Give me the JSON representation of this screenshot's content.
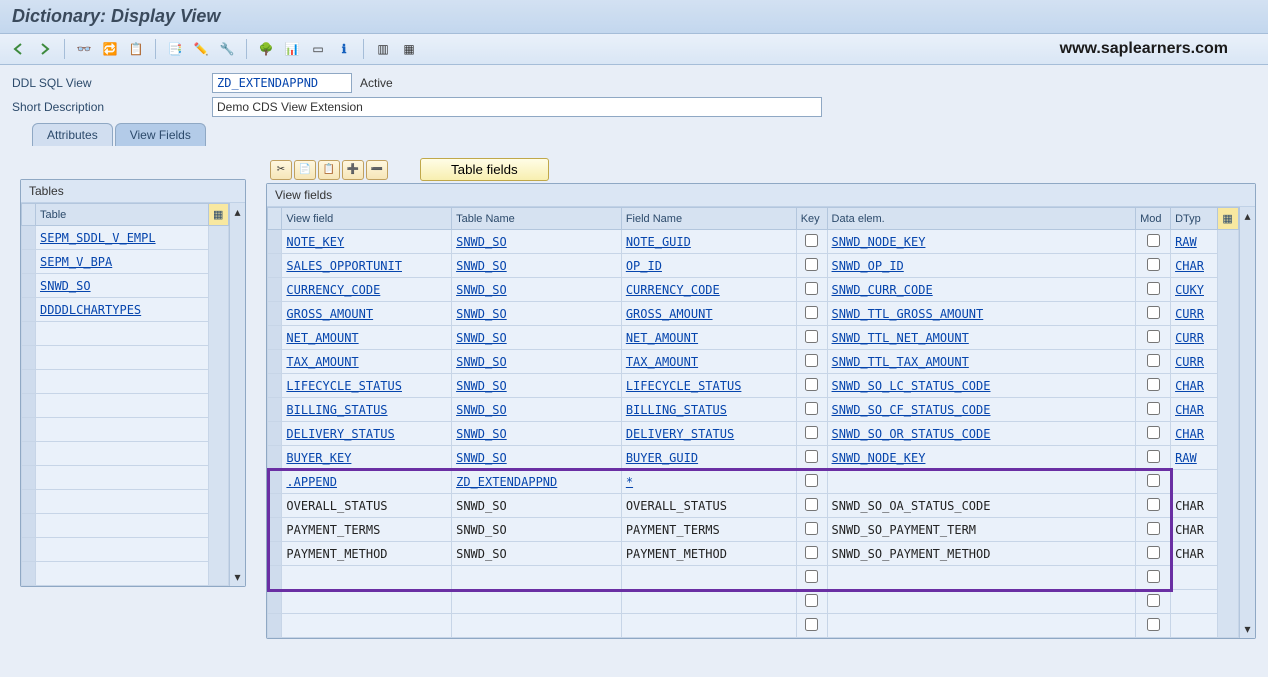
{
  "title": "Dictionary: Display View",
  "watermark": "www.saplearners.com",
  "form": {
    "ddl_label": "DDL SQL View",
    "ddl_value": "ZD_EXTENDAPPND",
    "status": "Active",
    "desc_label": "Short Description",
    "desc_value": "Demo CDS View Extension"
  },
  "tabs": {
    "attributes": "Attributes",
    "view_fields": "View Fields"
  },
  "left_panel": {
    "title": "Tables",
    "header": "Table",
    "rows": [
      "SEPM_SDDL_V_EMPL",
      "SEPM_V_BPA",
      "SNWD_SO",
      "DDDDLCHARTYPES"
    ]
  },
  "right_panel": {
    "title": "View fields",
    "button_table_fields": "Table fields",
    "headers": {
      "view_field": "View field",
      "table_name": "Table Name",
      "field_name": "Field Name",
      "key": "Key",
      "data_elem": "Data elem.",
      "mod": "Mod",
      "dtyp": "DTyp"
    },
    "rows": [
      {
        "vf": "NOTE_KEY",
        "tn": "SNWD_SO",
        "fn": "NOTE_GUID",
        "de": "SNWD_NODE_KEY",
        "dt": "RAW",
        "hl": false
      },
      {
        "vf": "SALES_OPPORTUNIT",
        "tn": "SNWD_SO",
        "fn": "OP_ID",
        "de": "SNWD_OP_ID",
        "dt": "CHAR",
        "hl": false
      },
      {
        "vf": "CURRENCY_CODE",
        "tn": "SNWD_SO",
        "fn": "CURRENCY_CODE",
        "de": "SNWD_CURR_CODE",
        "dt": "CUKY",
        "hl": false
      },
      {
        "vf": "GROSS_AMOUNT",
        "tn": "SNWD_SO",
        "fn": "GROSS_AMOUNT",
        "de": "SNWD_TTL_GROSS_AMOUNT",
        "dt": "CURR",
        "hl": false
      },
      {
        "vf": "NET_AMOUNT",
        "tn": "SNWD_SO",
        "fn": "NET_AMOUNT",
        "de": "SNWD_TTL_NET_AMOUNT",
        "dt": "CURR",
        "hl": false
      },
      {
        "vf": "TAX_AMOUNT",
        "tn": "SNWD_SO",
        "fn": "TAX_AMOUNT",
        "de": "SNWD_TTL_TAX_AMOUNT",
        "dt": "CURR",
        "hl": false
      },
      {
        "vf": "LIFECYCLE_STATUS",
        "tn": "SNWD_SO",
        "fn": "LIFECYCLE_STATUS",
        "de": "SNWD_SO_LC_STATUS_CODE",
        "dt": "CHAR",
        "hl": false
      },
      {
        "vf": "BILLING_STATUS",
        "tn": "SNWD_SO",
        "fn": "BILLING_STATUS",
        "de": "SNWD_SO_CF_STATUS_CODE",
        "dt": "CHAR",
        "hl": false
      },
      {
        "vf": "DELIVERY_STATUS",
        "tn": "SNWD_SO",
        "fn": "DELIVERY_STATUS",
        "de": "SNWD_SO_OR_STATUS_CODE",
        "dt": "CHAR",
        "hl": false
      },
      {
        "vf": "BUYER_KEY",
        "tn": "SNWD_SO",
        "fn": "BUYER_GUID",
        "de": "SNWD_NODE_KEY",
        "dt": "RAW",
        "hl": false
      },
      {
        "vf": ".APPEND",
        "tn": "ZD_EXTENDAPPND",
        "fn": "*",
        "de": "",
        "dt": "",
        "hl": true
      },
      {
        "vf": "OVERALL_STATUS",
        "tn": "SNWD_SO",
        "fn": "OVERALL_STATUS",
        "de": "SNWD_SO_OA_STATUS_CODE",
        "dt": "CHAR",
        "hl": true,
        "plain": true
      },
      {
        "vf": "PAYMENT_TERMS",
        "tn": "SNWD_SO",
        "fn": "PAYMENT_TERMS",
        "de": "SNWD_SO_PAYMENT_TERM",
        "dt": "CHAR",
        "hl": true,
        "plain": true
      },
      {
        "vf": "PAYMENT_METHOD",
        "tn": "SNWD_SO",
        "fn": "PAYMENT_METHOD",
        "de": "SNWD_SO_PAYMENT_METHOD",
        "dt": "CHAR",
        "hl": true,
        "plain": true
      },
      {
        "vf": "",
        "tn": "",
        "fn": "",
        "de": "",
        "dt": "",
        "hl": true,
        "plain": true
      },
      {
        "vf": "",
        "tn": "",
        "fn": "",
        "de": "",
        "dt": "",
        "hl": false,
        "plain": true
      },
      {
        "vf": "",
        "tn": "",
        "fn": "",
        "de": "",
        "dt": "",
        "hl": false,
        "plain": true
      }
    ]
  }
}
